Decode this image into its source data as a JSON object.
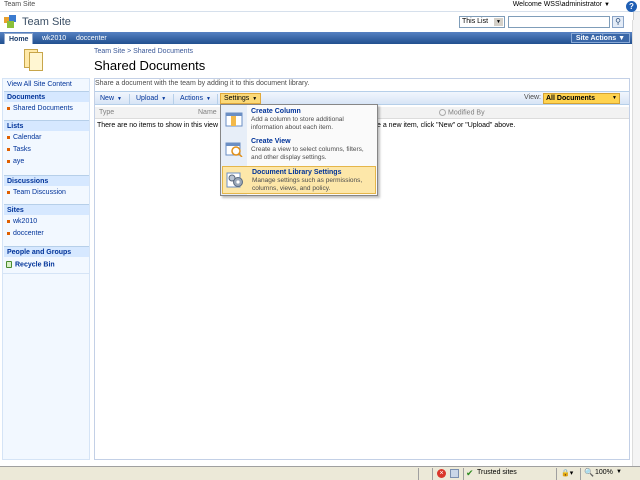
{
  "topbar": {
    "site_crumb": "Team Site",
    "welcome": "Welcome WSS\\administrator",
    "help_label": "?"
  },
  "title_area": {
    "site_title": "Team Site",
    "search_scope": "This List",
    "search_placeholder": ""
  },
  "nav": {
    "tabs": [
      {
        "label": "Home",
        "active": true
      },
      {
        "label": "wk2010",
        "active": false
      },
      {
        "label": "doccenter",
        "active": false
      }
    ],
    "site_actions": "Site Actions"
  },
  "header": {
    "breadcrumb": "Team Site > Shared Documents",
    "page_title": "Shared Documents"
  },
  "leftnav": {
    "view_all": "View All Site Content",
    "sections": [
      {
        "heading": "Documents",
        "items": [
          "Shared Documents"
        ]
      },
      {
        "heading": "Lists",
        "items": [
          "Calendar",
          "Tasks",
          "aye"
        ]
      },
      {
        "heading": "Discussions",
        "items": [
          "Team Discussion"
        ]
      },
      {
        "heading": "Sites",
        "items": [
          "wk2010",
          "doccenter"
        ]
      },
      {
        "heading": "People and Groups",
        "items": []
      }
    ],
    "recycle_bin": "Recycle Bin"
  },
  "main": {
    "description": "Share a document with the team by adding it to this document library.",
    "toolbar": {
      "new": "New",
      "upload": "Upload",
      "actions": "Actions",
      "settings": "Settings",
      "view_label": "View:",
      "view_value": "All Documents"
    },
    "columns": [
      "Type",
      "Name",
      "Modified By"
    ],
    "empty_message_left": "There are no items to show in this view of",
    "empty_message_right": "e a new item, click \"New\" or \"Upload\" above."
  },
  "settings_menu": {
    "items": [
      {
        "title": "Create Column",
        "desc": "Add a column to store additional information about each item.",
        "icon": "create-column-icon",
        "highlighted": false
      },
      {
        "title": "Create View",
        "desc": "Create a view to select columns, filters, and other display settings.",
        "icon": "create-view-icon",
        "highlighted": false
      },
      {
        "title": "Document Library Settings",
        "desc": "Manage settings such as permissions, columns, views, and policy.",
        "icon": "library-settings-icon",
        "highlighted": true
      }
    ]
  },
  "statusbar": {
    "zone": "Trusted sites",
    "zoom": "100%"
  },
  "colors": {
    "nav_blue": "#21508f",
    "highlight": "#fde7a9",
    "view_select": "#ffd34f",
    "link": "#003399"
  }
}
